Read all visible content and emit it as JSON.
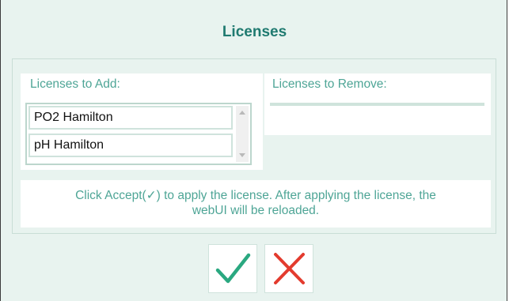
{
  "dialog": {
    "title": "Licenses"
  },
  "licenses_to_add": {
    "label": "Licenses to Add:",
    "items": [
      {
        "label": "PO2 Hamilton"
      },
      {
        "label": "pH Hamilton"
      }
    ]
  },
  "licenses_to_remove": {
    "label": "Licenses to Remove:"
  },
  "info": {
    "line1": "Click Accept(✓) to apply the license. After applying the license, the",
    "line2": "webUI will be reloaded."
  },
  "buttons": {
    "accept_icon": "check-icon",
    "reject_icon": "close-icon"
  },
  "colors": {
    "accent": "#1f7a70",
    "label": "#4ea596",
    "accept": "#2aa880",
    "reject": "#e33b2e",
    "background": "#e8f3ef"
  }
}
